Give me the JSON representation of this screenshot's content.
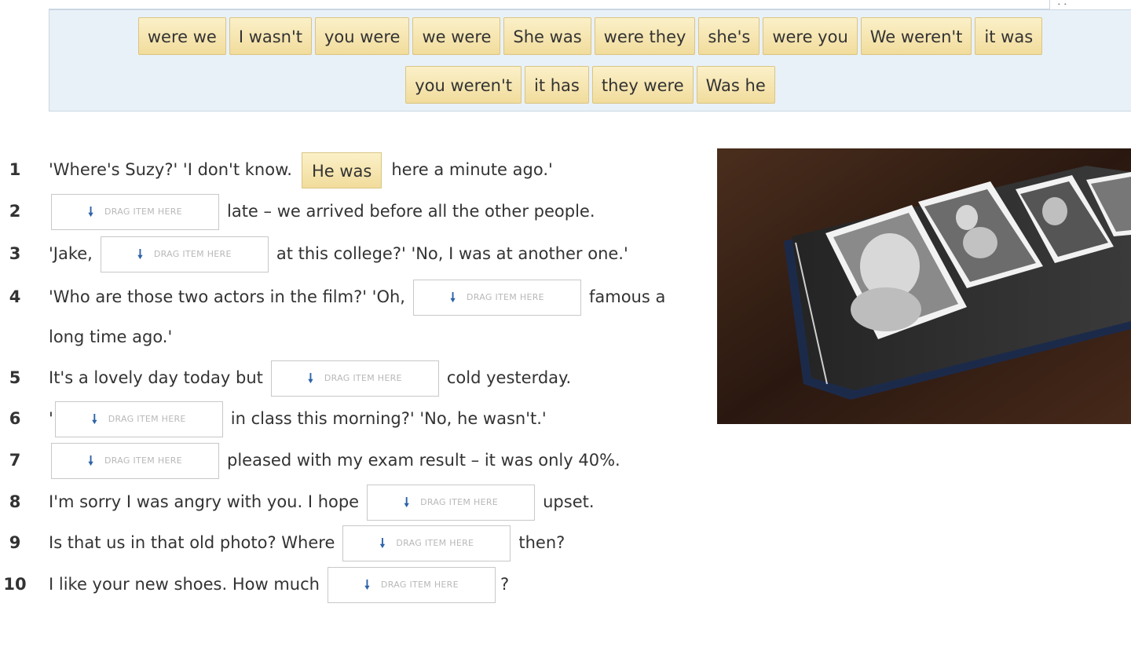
{
  "word_bank": {
    "row1": [
      "were we",
      "I wasn't",
      "you were",
      "we were",
      "She was",
      "were they",
      "she's",
      "were you",
      "We weren't",
      "it was"
    ],
    "row2": [
      "you weren't",
      "it has",
      "they were",
      "Was he"
    ]
  },
  "drop_hint": "DRAG ITEM HERE",
  "questions": [
    {
      "num": "1",
      "before": "'Where's Suzy?' 'I don't know.",
      "answer": "He was",
      "after": "here a minute ago.'"
    },
    {
      "num": "2",
      "before": "",
      "after": "late – we arrived before all the other people."
    },
    {
      "num": "3",
      "before": "'Jake,",
      "after": "at this college?' 'No, I was at another one.'"
    },
    {
      "num": "4",
      "before": "'Who are those two actors in the film?' 'Oh,",
      "after": "famous a",
      "continuation": "long time ago.'"
    },
    {
      "num": "5",
      "before": "It's a lovely day today but",
      "after": "cold yesterday."
    },
    {
      "num": "6",
      "before": "'",
      "after": "in class this morning?' 'No, he wasn't.'"
    },
    {
      "num": "7",
      "before": "",
      "after": "pleased with my exam result – it was only 40%."
    },
    {
      "num": "8",
      "before": "I'm sorry I was angry with you. I hope",
      "after": "upset."
    },
    {
      "num": "9",
      "before": "Is that us in that old photo? Where",
      "after": "then?"
    },
    {
      "num": "10",
      "before": "I like your new shoes. How much",
      "after": "?"
    }
  ],
  "colors": {
    "chip": "#f5e3ad",
    "bank_bg": "#e9f1f8",
    "arrow": "#2d63a8"
  }
}
